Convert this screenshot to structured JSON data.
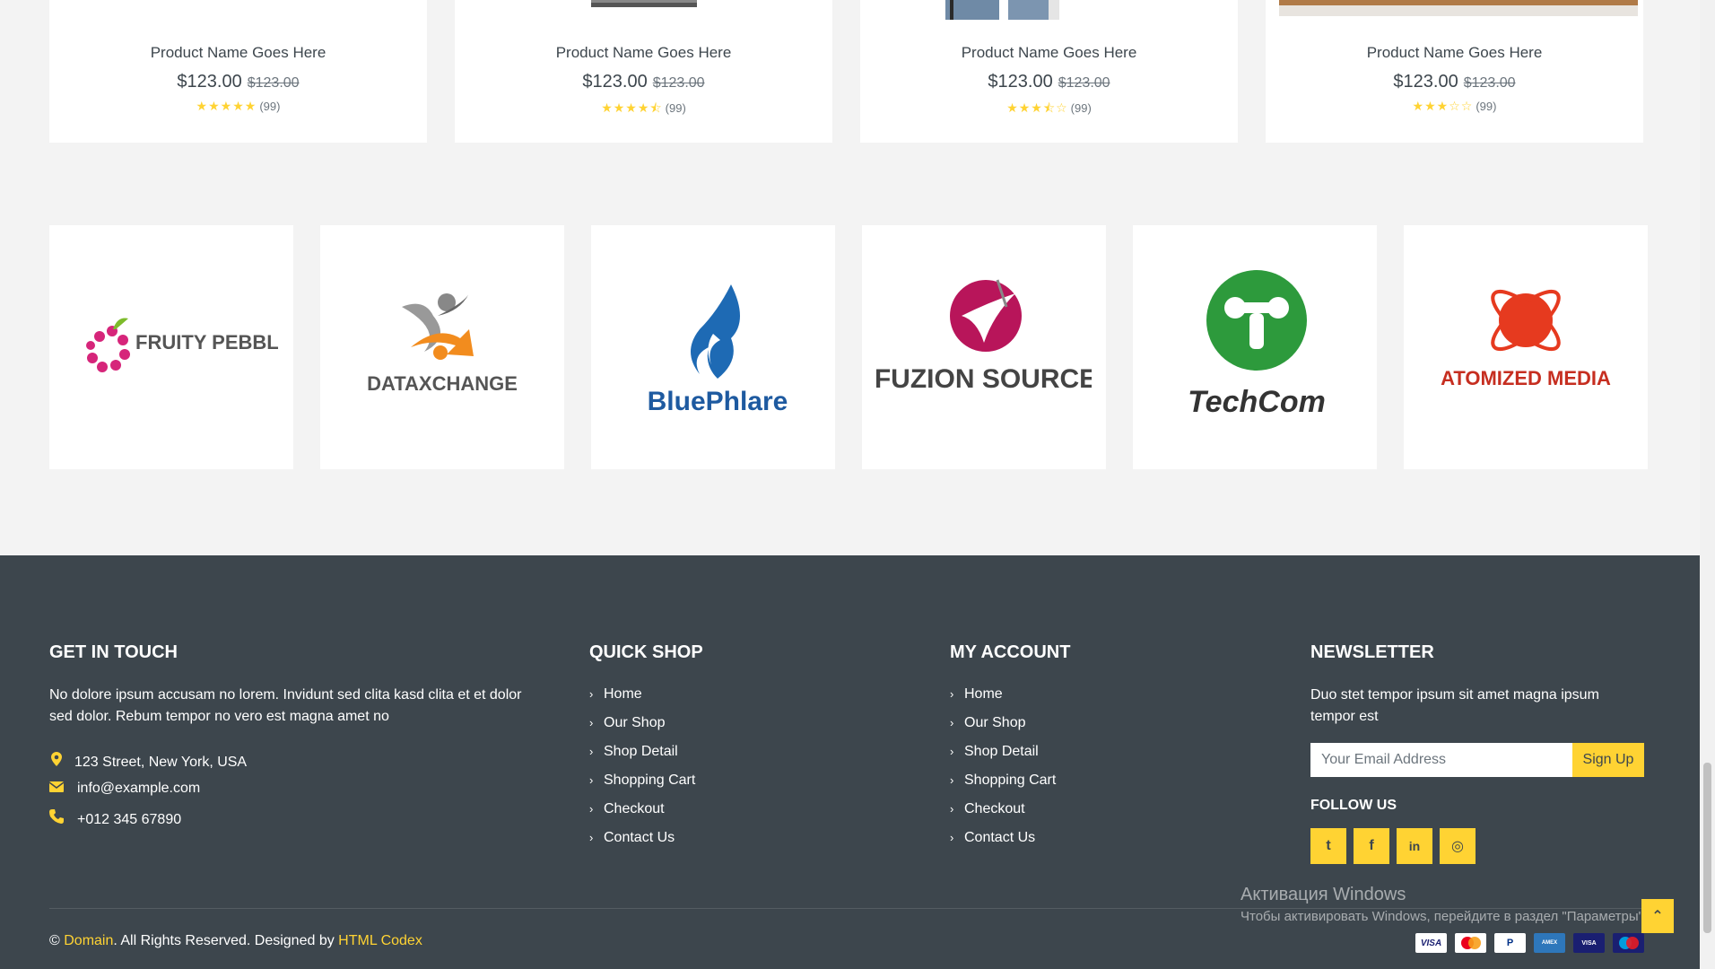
{
  "products": [
    {
      "name": "Product Name Goes Here",
      "price": "$123.00",
      "old_price": "$123.00",
      "stars": "★★★★★",
      "rating": 5,
      "reviews": "(99)"
    },
    {
      "name": "Product Name Goes Here",
      "price": "$123.00",
      "old_price": "$123.00",
      "stars": "★★★★⯪",
      "rating": 4.5,
      "reviews": "(99)"
    },
    {
      "name": "Product Name Goes Here",
      "price": "$123.00",
      "old_price": "$123.00",
      "stars": "★★★⯪☆",
      "rating": 3.5,
      "reviews": "(99)"
    },
    {
      "name": "Product Name Goes Here",
      "price": "$123.00",
      "old_price": "$123.00",
      "stars": "★★★☆☆",
      "rating": 3,
      "reviews": "(99)"
    }
  ],
  "vendors": [
    {
      "name": "FRUITY PEBBLES",
      "logo": "fruity-pebbles-logo"
    },
    {
      "name": "DATAXCHANGE",
      "logo": "dataxchange-logo"
    },
    {
      "name": "BluePhlare",
      "logo": "bluephlare-logo"
    },
    {
      "name": "FUZION SOURCE",
      "logo": "fuzion-logo"
    },
    {
      "name": "TechCom",
      "logo": "techcom-logo"
    },
    {
      "name": "ATOMIZED MEDIA",
      "logo": "atomized-media-logo"
    }
  ],
  "footer": {
    "contact": {
      "title": "Get In Touch",
      "text": "No dolore ipsum accusam no lorem. Invidunt sed clita kasd clita et et dolor sed dolor. Rebum tempor no vero est magna amet no",
      "address": "123 Street, New York, USA",
      "email": "info@example.com",
      "phone": "+012 345 67890",
      "icons": {
        "address": "map-marker-icon",
        "email": "envelope-icon",
        "phone": "phone-icon"
      }
    },
    "quick_shop": {
      "title": "Quick Shop",
      "links": [
        "Home",
        "Our Shop",
        "Shop Detail",
        "Shopping Cart",
        "Checkout",
        "Contact Us"
      ]
    },
    "my_account": {
      "title": "My Account",
      "links": [
        "Home",
        "Our Shop",
        "Shop Detail",
        "Shopping Cart",
        "Checkout",
        "Contact Us"
      ]
    },
    "newsletter": {
      "title": "Newsletter",
      "text": "Duo stet tempor ipsum sit amet magna ipsum tempor est",
      "placeholder": "Your Email Address",
      "button": "Sign Up",
      "follow_title": "Follow Us",
      "social": [
        {
          "icon": "twitter-icon",
          "glyph": "t"
        },
        {
          "icon": "facebook-icon",
          "glyph": "f"
        },
        {
          "icon": "linkedin-icon",
          "glyph": "in"
        },
        {
          "icon": "instagram-icon",
          "glyph": "◎"
        }
      ]
    },
    "copyright": {
      "prefix": "© ",
      "domain": "Domain",
      "middle": ". All Rights Reserved. Designed by ",
      "designer": "HTML Codex"
    },
    "payments": [
      "VISA",
      "MasterCard",
      "PayPal",
      "AMERICAN EXPRESS",
      "VISA Electron",
      "Maestro"
    ]
  },
  "watermark": {
    "line1": "Активация Windows",
    "line2": "Чтобы активировать Windows, перейдите в раздел \"Параметры\"."
  },
  "colors": {
    "accent": "#ffd333",
    "dark": "#3d464d",
    "page_bg": "#f3f3f3"
  }
}
